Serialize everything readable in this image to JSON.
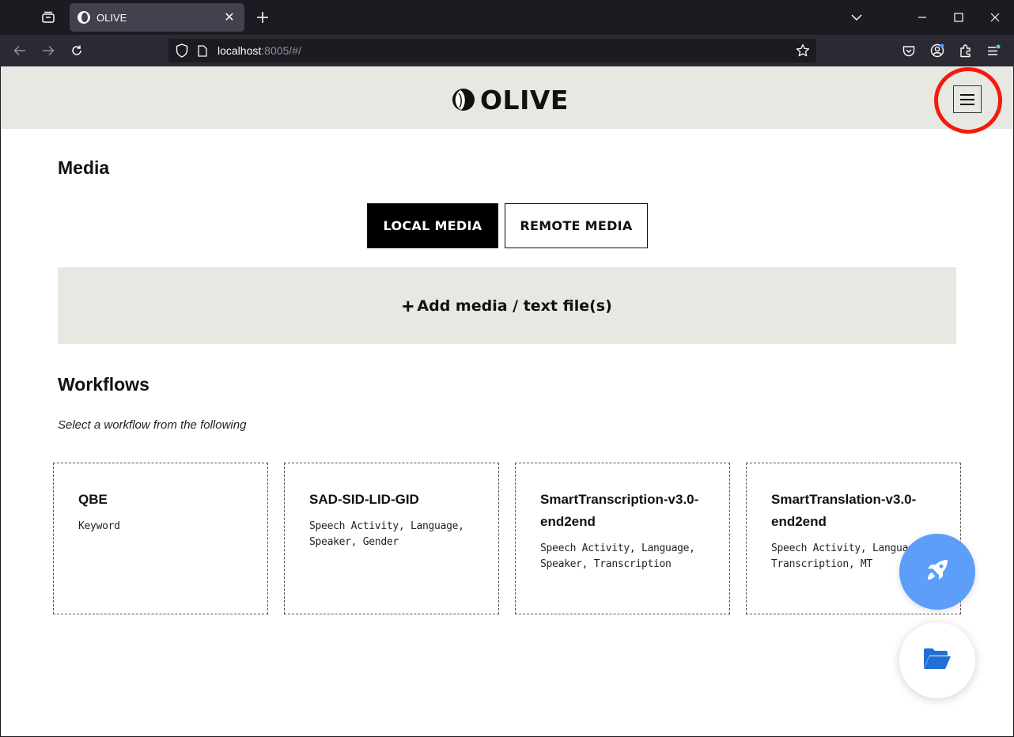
{
  "browser": {
    "tab_title": "OLIVE",
    "url_host": "localhost",
    "url_rest": ":8005/#/",
    "icons": {
      "tab_list": "tab-list-icon",
      "new_tab": "plus-icon",
      "back": "arrow-left-icon",
      "forward": "arrow-right-icon",
      "reload": "reload-icon",
      "shield": "shield-icon",
      "page": "page-icon",
      "bookmark": "star-icon",
      "pocket": "pocket-icon",
      "account": "account-icon",
      "extensions": "puzzle-icon",
      "app_menu": "hamburger-icon"
    }
  },
  "app": {
    "logo_text": "OLIVE",
    "menu_icon": "hamburger-icon",
    "highlight_color": "#f21c0e"
  },
  "media": {
    "title": "Media",
    "local_label": "LOCAL MEDIA",
    "remote_label": "REMOTE MEDIA",
    "add_label": "Add media / text file(s)"
  },
  "workflows": {
    "title": "Workflows",
    "subtitle": "Select a workflow from the following",
    "cards": [
      {
        "name": "QBE",
        "desc": "Keyword"
      },
      {
        "name": "SAD-SID-LID-GID",
        "desc": "Speech Activity, Language, Speaker, Gender"
      },
      {
        "name": "SmartTranscription-v3.0-end2end",
        "desc": "Speech Activity, Language, Speaker, Transcription"
      },
      {
        "name": "SmartTranslation-v3.0-end2end",
        "desc": "Speech Activity, Language, Transcription, MT"
      }
    ]
  },
  "fabs": {
    "launch_icon": "rocket-icon",
    "launch_color": "#5c9ef8",
    "folder_icon": "folder-open-icon",
    "folder_color": "#1f6fd6"
  }
}
